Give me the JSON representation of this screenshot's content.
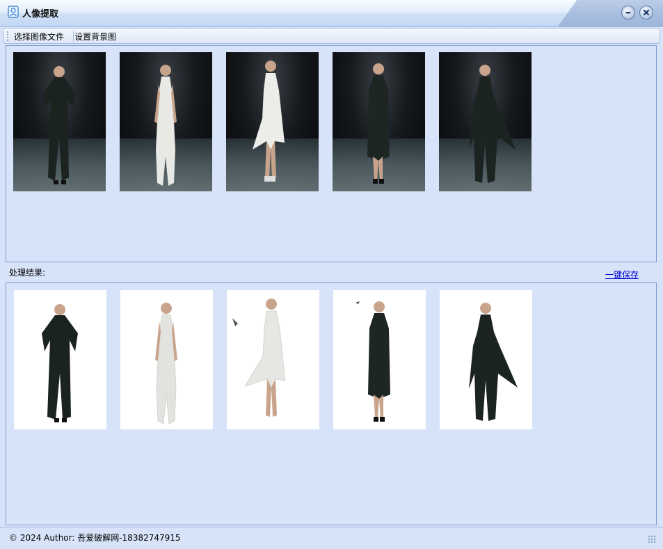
{
  "window": {
    "title": "人像提取",
    "icon": "portrait-app-icon",
    "controls": [
      "minimize-icon",
      "close-icon"
    ]
  },
  "toolbar": {
    "select_file_label": "选择图像文件",
    "set_background_label": "设置背景图"
  },
  "source_images": [
    {
      "outfit": "black"
    },
    {
      "outfit": "white"
    },
    {
      "outfit": "white"
    },
    {
      "outfit": "black"
    },
    {
      "outfit": "black"
    }
  ],
  "results": {
    "label": "处理结果:",
    "save_all_label": "一键保存",
    "images": [
      {
        "outfit": "black"
      },
      {
        "outfit": "white"
      },
      {
        "outfit": "white"
      },
      {
        "outfit": "black"
      },
      {
        "outfit": "black"
      }
    ]
  },
  "status": {
    "text": "© 2024 Author: 吾爱破解网-18382747915"
  },
  "colors": {
    "background": "#d6e3f8",
    "panel_border": "#7f9bc8",
    "link": "#0000d0"
  }
}
